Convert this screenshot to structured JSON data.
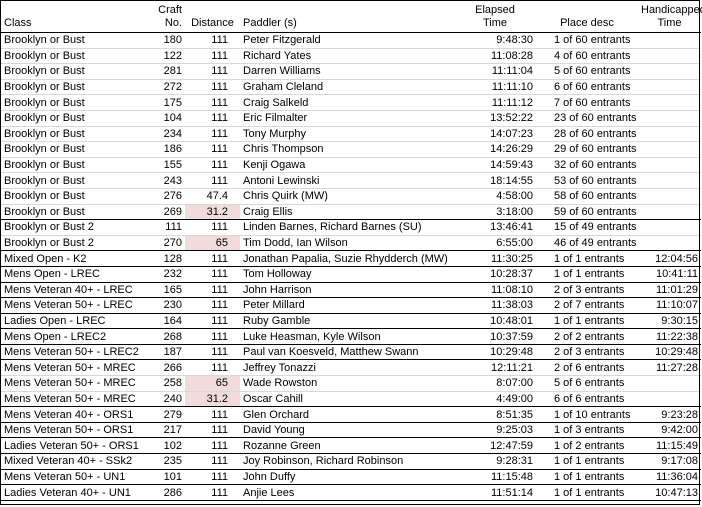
{
  "headers": {
    "class": "Class",
    "craft": "Craft No.",
    "distance": "Distance",
    "paddler": "Paddler (s)",
    "elapsed_l1": "Elapsed",
    "elapsed_l2": "Time",
    "place": "Place desc",
    "handicapped_l1": "Handicapped",
    "handicapped_l2": "Time"
  },
  "rows": [
    {
      "cls": "Brooklyn or Bust",
      "craft": "180",
      "dist": "111",
      "paddler": "Peter Fitzgerald",
      "elapsed": "9:48:30",
      "place": "1 of 60  entrants",
      "hcap": "",
      "hl": false,
      "end": false
    },
    {
      "cls": "Brooklyn or Bust",
      "craft": "122",
      "dist": "111",
      "paddler": "Richard Yates",
      "elapsed": "11:08:28",
      "place": "4 of 60  entrants",
      "hcap": "",
      "hl": false,
      "end": false
    },
    {
      "cls": "Brooklyn or Bust",
      "craft": "281",
      "dist": "111",
      "paddler": "Darren Williams",
      "elapsed": "11:11:04",
      "place": "5 of 60  entrants",
      "hcap": "",
      "hl": false,
      "end": false
    },
    {
      "cls": "Brooklyn or Bust",
      "craft": "272",
      "dist": "111",
      "paddler": "Graham Cleland",
      "elapsed": "11:11:10",
      "place": "6 of 60  entrants",
      "hcap": "",
      "hl": false,
      "end": false
    },
    {
      "cls": "Brooklyn or Bust",
      "craft": "175",
      "dist": "111",
      "paddler": "Craig Salkeld",
      "elapsed": "11:11:12",
      "place": "7 of 60  entrants",
      "hcap": "",
      "hl": false,
      "end": false
    },
    {
      "cls": "Brooklyn or Bust",
      "craft": "104",
      "dist": "111",
      "paddler": "Eric Filmalter",
      "elapsed": "13:52:22",
      "place": "23 of 60  entrants",
      "hcap": "",
      "hl": false,
      "end": false
    },
    {
      "cls": "Brooklyn or Bust",
      "craft": "234",
      "dist": "111",
      "paddler": "Tony Murphy",
      "elapsed": "14:07:23",
      "place": "28 of 60  entrants",
      "hcap": "",
      "hl": false,
      "end": false
    },
    {
      "cls": "Brooklyn or Bust",
      "craft": "186",
      "dist": "111",
      "paddler": "Chris Thompson",
      "elapsed": "14:26:29",
      "place": "29 of 60  entrants",
      "hcap": "",
      "hl": false,
      "end": false
    },
    {
      "cls": "Brooklyn or Bust",
      "craft": "155",
      "dist": "111",
      "paddler": "Kenji Ogawa",
      "elapsed": "14:59:43",
      "place": "32 of 60  entrants",
      "hcap": "",
      "hl": false,
      "end": false
    },
    {
      "cls": "Brooklyn or Bust",
      "craft": "243",
      "dist": "111",
      "paddler": "Antoni Lewinski",
      "elapsed": "18:14:55",
      "place": "53 of 60  entrants",
      "hcap": "",
      "hl": false,
      "end": false
    },
    {
      "cls": "Brooklyn or Bust",
      "craft": "276",
      "dist": "47.4",
      "paddler": "Chris Quirk (MW)",
      "elapsed": "4:58:00",
      "place": "58 of 60  entrants",
      "hcap": "",
      "hl": false,
      "end": false
    },
    {
      "cls": "Brooklyn or Bust",
      "craft": "269",
      "dist": "31.2",
      "paddler": "Craig Ellis",
      "elapsed": "3:18:00",
      "place": "59 of 60  entrants",
      "hcap": "",
      "hl": true,
      "end": true
    },
    {
      "cls": "Brooklyn or Bust 2",
      "craft": "111",
      "dist": "111",
      "paddler": "Linden Barnes, Richard Barnes (SU)",
      "elapsed": "13:46:41",
      "place": "15 of 49  entrants",
      "hcap": "",
      "hl": false,
      "end": false
    },
    {
      "cls": "Brooklyn or Bust 2",
      "craft": "270",
      "dist": "65",
      "paddler": "Tim Dodd, Ian Wilson",
      "elapsed": "6:55:00",
      "place": "46 of 49  entrants",
      "hcap": "",
      "hl": true,
      "end": true
    },
    {
      "cls": "Mixed Open - K2",
      "craft": "128",
      "dist": "111",
      "paddler": "Jonathan Papalia, Suzie Rhydderch (MW)",
      "elapsed": "11:30:25",
      "place": "1 of 1  entrants",
      "hcap": "12:04:56",
      "hl": false,
      "end": true
    },
    {
      "cls": "Mens Open - LREC",
      "craft": "232",
      "dist": "111",
      "paddler": "Tom Holloway",
      "elapsed": "10:28:37",
      "place": "1 of 1  entrants",
      "hcap": "10:41:11",
      "hl": false,
      "end": true
    },
    {
      "cls": "Mens Veteran 40+ - LREC",
      "craft": "165",
      "dist": "111",
      "paddler": "John Harrison",
      "elapsed": "11:08:10",
      "place": "2 of 3  entrants",
      "hcap": "11:01:29",
      "hl": false,
      "end": true
    },
    {
      "cls": "Mens Veteran 50+ - LREC",
      "craft": "230",
      "dist": "111",
      "paddler": "Peter Millard",
      "elapsed": "11:38:03",
      "place": "2 of 7  entrants",
      "hcap": "11:10:07",
      "hl": false,
      "end": true
    },
    {
      "cls": "Ladies Open - LREC",
      "craft": "164",
      "dist": "111",
      "paddler": "Ruby Gamble",
      "elapsed": "10:48:01",
      "place": "1 of 1  entrants",
      "hcap": "9:30:15",
      "hl": false,
      "end": true
    },
    {
      "cls": "Mens Open - LREC2",
      "craft": "268",
      "dist": "111",
      "paddler": "Luke Heasman, Kyle Wilson",
      "elapsed": "10:37:59",
      "place": "2 of 2  entrants",
      "hcap": "11:22:38",
      "hl": false,
      "end": true
    },
    {
      "cls": "Mens Veteran 50+ - LREC2",
      "craft": "187",
      "dist": "111",
      "paddler": "Paul van Koesveld, Matthew Swann",
      "elapsed": "10:29:48",
      "place": "2 of 3  entrants",
      "hcap": "10:29:48",
      "hl": false,
      "end": true
    },
    {
      "cls": "Mens Veteran 50+ - MREC",
      "craft": "266",
      "dist": "111",
      "paddler": "Jeffrey Tonazzi",
      "elapsed": "12:11:21",
      "place": "2 of 6  entrants",
      "hcap": "11:27:28",
      "hl": false,
      "end": false
    },
    {
      "cls": "Mens Veteran 50+ - MREC",
      "craft": "258",
      "dist": "65",
      "paddler": "Wade Rowston",
      "elapsed": "8:07:00",
      "place": "5 of 6  entrants",
      "hcap": "",
      "hl": true,
      "end": false
    },
    {
      "cls": "Mens Veteran 50+ - MREC",
      "craft": "240",
      "dist": "31.2",
      "paddler": "Oscar Cahill",
      "elapsed": "4:49:00",
      "place": "6 of 6  entrants",
      "hcap": "",
      "hl": true,
      "end": true
    },
    {
      "cls": "Mens Veteran 40+ - ORS1",
      "craft": "279",
      "dist": "111",
      "paddler": "Glen Orchard",
      "elapsed": "8:51:35",
      "place": "1 of 10  entrants",
      "hcap": "9:23:28",
      "hl": false,
      "end": true
    },
    {
      "cls": "Mens Veteran 50+ - ORS1",
      "craft": "217",
      "dist": "111",
      "paddler": "David Young",
      "elapsed": "9:25:03",
      "place": "1 of 3  entrants",
      "hcap": "9:42:00",
      "hl": false,
      "end": true
    },
    {
      "cls": "Ladies Veteran 50+ - ORS1",
      "craft": "102",
      "dist": "111",
      "paddler": "Rozanne Green",
      "elapsed": "12:47:59",
      "place": "1 of 2  entrants",
      "hcap": "11:15:49",
      "hl": false,
      "end": true
    },
    {
      "cls": "Mixed Veteran 40+ - SSk2",
      "craft": "235",
      "dist": "111",
      "paddler": "Joy Robinson, Richard Robinson",
      "elapsed": "9:28:31",
      "place": "1 of 1  entrants",
      "hcap": "9:17:08",
      "hl": false,
      "end": true
    },
    {
      "cls": "Mens Veteran 50+ - UN1",
      "craft": "101",
      "dist": "111",
      "paddler": "John Duffy",
      "elapsed": "11:15:48",
      "place": "1 of 1  entrants",
      "hcap": "11:36:04",
      "hl": false,
      "end": true
    },
    {
      "cls": "Ladies Veteran 40+ - UN1",
      "craft": "286",
      "dist": "111",
      "paddler": "Anjie Lees",
      "elapsed": "11:51:14",
      "place": "1 of 1  entrants",
      "hcap": "10:47:13",
      "hl": false,
      "end": true
    }
  ]
}
